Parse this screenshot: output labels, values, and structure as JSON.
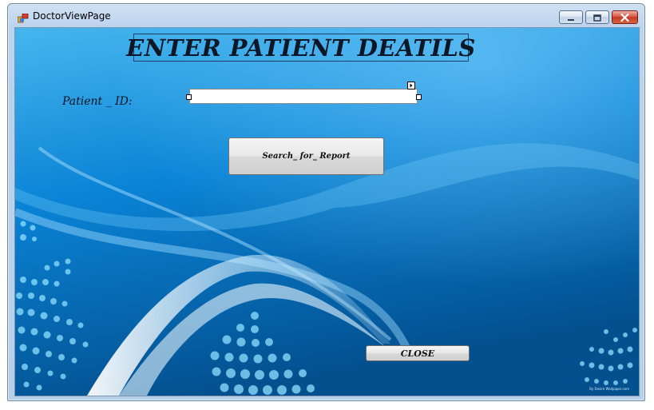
{
  "window": {
    "title": "DoctorViewPage",
    "buttons": {
      "minimize": "minimize",
      "maximize": "maximize",
      "close": "close"
    }
  },
  "form": {
    "heading": "ENTER PATIENT DEATILS",
    "patient_id_label": "Patient _ ID:",
    "patient_id_value": "",
    "search_button_label": "Search_ for_ Report",
    "close_button_label": "CLOSE"
  },
  "background": {
    "credit": "By Desire Wallpaper.com"
  },
  "colors": {
    "background_top": "#3aa9e6",
    "background_mid": "#0a7ed0",
    "background_bottom": "#03508f",
    "close_accent": "#c23a26"
  },
  "icons": [
    "app-icon",
    "minimize-icon",
    "maximize-icon",
    "close-icon",
    "smart-tag-arrow-icon"
  ]
}
